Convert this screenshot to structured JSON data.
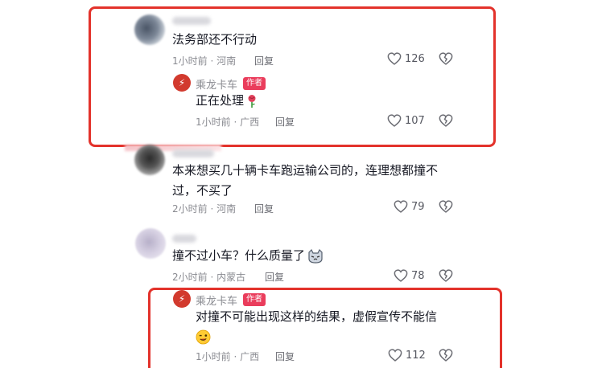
{
  "comments": [
    {
      "text": "法务部还不行动",
      "meta": "1小时前 · 河南",
      "reply_label": "回复",
      "likes": "126"
    },
    {
      "text_line1": "本来想买几十辆卡车跑运输公司的，连理想都撞不",
      "text_line2": "过，不买了",
      "meta": "2小时前 · 河南",
      "reply_label": "回复",
      "likes": "79"
    },
    {
      "text": "撞不过小车？什么质量了",
      "meta": "2小时前 · 内蒙古",
      "reply_label": "回复",
      "likes": "78"
    }
  ],
  "author_replies": [
    {
      "author": "乘龙卡车",
      "tag": "作者",
      "text": "正在处理",
      "meta": "1小时前 · 广西",
      "reply_label": "回复",
      "likes": "107"
    },
    {
      "author": "乘龙卡车",
      "tag": "作者",
      "text": "对撞不可能出现这样的结果，虚假宣传不能信",
      "meta": "1小时前 · 广西",
      "reply_label": "回复",
      "likes": "112"
    }
  ],
  "icons": {
    "like": "heart-outline-icon",
    "dislike": "broken-heart-icon",
    "rose": "rose-emoji-icon",
    "cat": "cat-emoji-icon",
    "wink": "wink-emoji-icon",
    "author_avatar": "truck-logo-icon"
  },
  "colors": {
    "highlight_border": "#e3322b",
    "author_tag_bg": "#ea3d5c",
    "meta_text": "#8a8b91"
  }
}
